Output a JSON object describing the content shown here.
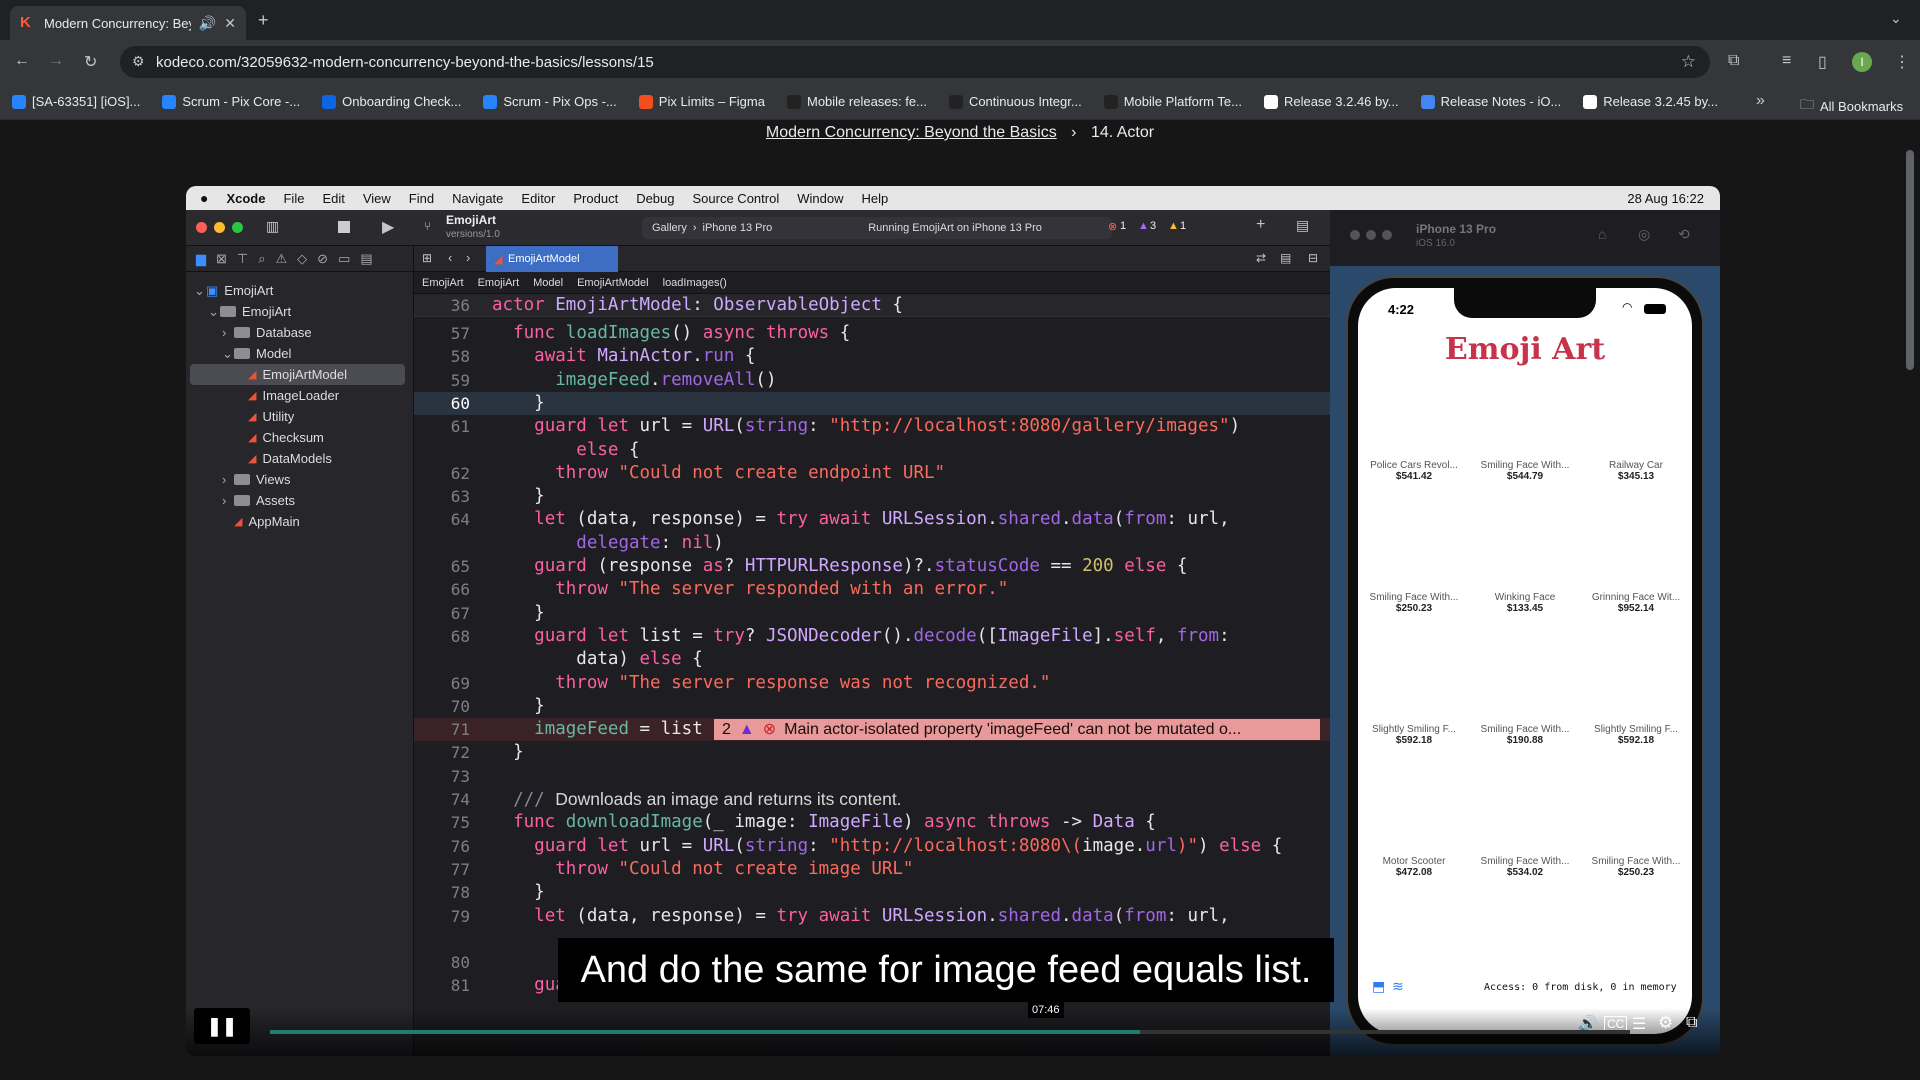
{
  "browser": {
    "tab_title": "Modern Concurrency: Beyo",
    "url": "kodeco.com/32059632-modern-concurrency-beyond-the-basics/lessons/15",
    "bookmarks": [
      {
        "label": "[SA-63351] [iOS]...",
        "color": "#2684ff"
      },
      {
        "label": "Scrum - Pix Core -...",
        "color": "#2684ff"
      },
      {
        "label": "Onboarding Check...",
        "color": "#0c66e4"
      },
      {
        "label": "Scrum - Pix Ops -...",
        "color": "#2684ff"
      },
      {
        "label": "Pix Limits – Figma",
        "color": "#f24e1e"
      },
      {
        "label": "Mobile releases: fe...",
        "color": "#222222"
      },
      {
        "label": "Continuous Integr...",
        "color": "#222222"
      },
      {
        "label": "Mobile Platform Te...",
        "color": "#222222"
      },
      {
        "label": "Release 3.2.46 by...",
        "color": "#ffffff"
      },
      {
        "label": "Release Notes - iO...",
        "color": "#4285f4"
      },
      {
        "label": "Release 3.2.45 by...",
        "color": "#ffffff"
      }
    ],
    "all_bookmarks": "All Bookmarks",
    "more": "»"
  },
  "breadcrumb": {
    "course": "Modern Concurrency: Beyond the Basics",
    "sep": "›",
    "lesson": "14. Actor"
  },
  "mac_menu": [
    "Xcode",
    "File",
    "Edit",
    "View",
    "Find",
    "Navigate",
    "Editor",
    "Product",
    "Debug",
    "Source Control",
    "Window",
    "Help"
  ],
  "mac_status": "28 Aug  16:22",
  "xcode": {
    "project": "EmojiArt",
    "version": "versions/1.0",
    "scheme": "Gallery",
    "device": "iPhone 13 Pro",
    "status": "Running EmojiArt on iPhone 13 Pro",
    "errors": "1",
    "warnings_purple": "3",
    "warnings_yellow": "1",
    "file_tab": "EmojiArtModel",
    "jump": [
      "EmojiArt",
      "EmojiArt",
      "Model",
      "EmojiArtModel",
      "loadImages()"
    ],
    "navigator": [
      {
        "label": "EmojiArt",
        "depth": 0,
        "kind": "project",
        "arrow": "⌄"
      },
      {
        "label": "EmojiArt",
        "depth": 1,
        "kind": "folder",
        "arrow": "⌄"
      },
      {
        "label": "Database",
        "depth": 2,
        "kind": "folder",
        "arrow": "›"
      },
      {
        "label": "Model",
        "depth": 2,
        "kind": "folder",
        "arrow": "⌄"
      },
      {
        "label": "EmojiArtModel",
        "depth": 3,
        "kind": "swift",
        "arrow": ""
      },
      {
        "label": "ImageLoader",
        "depth": 3,
        "kind": "swift",
        "arrow": ""
      },
      {
        "label": "Utility",
        "depth": 3,
        "kind": "swift",
        "arrow": ""
      },
      {
        "label": "Checksum",
        "depth": 3,
        "kind": "swift",
        "arrow": ""
      },
      {
        "label": "DataModels",
        "depth": 3,
        "kind": "swift",
        "arrow": ""
      },
      {
        "label": "Views",
        "depth": 2,
        "kind": "folder",
        "arrow": "›"
      },
      {
        "label": "Assets",
        "depth": 2,
        "kind": "folder",
        "arrow": "›"
      },
      {
        "label": "AppMain",
        "depth": 2,
        "kind": "swift",
        "arrow": ""
      }
    ],
    "sticky_line": {
      "num": "36",
      "html": "<span class='kw'>actor</span> <span class='ty'>EmojiArtModel</span>: <span class='ty'>ObservableObject</span> {"
    },
    "code": [
      {
        "num": "57",
        "html": "  <span class='kw'>func</span> <span class='fn'>loadImages</span>() <span class='kw'>async throws</span> {"
      },
      {
        "num": "58",
        "html": "    <span class='kw'>await</span> <span class='ty'>MainActor</span>.<span class='id'>run</span> {"
      },
      {
        "num": "59",
        "html": "      <span class='fn'>imageFeed</span>.<span class='id'>removeAll</span>()"
      },
      {
        "num": "60",
        "html": "    }",
        "current": true
      },
      {
        "num": "61",
        "html": "    <span class='kw'>guard let</span> url = <span class='ty'>URL</span>(<span class='id'>string</span>: <span class='st'>\"http://localhost:8080/gallery/images\"</span>)"
      },
      {
        "num": "",
        "html": "        <span class='kw'>else</span> {"
      },
      {
        "num": "62",
        "html": "      <span class='kw'>throw</span> <span class='st'>\"Could not create endpoint URL\"</span>"
      },
      {
        "num": "63",
        "html": "    }"
      },
      {
        "num": "64",
        "html": "    <span class='kw'>let</span> (data, response) = <span class='kw'>try await</span> <span class='ty'>URLSession</span>.<span class='id'>shared</span>.<span class='id'>data</span>(<span class='id'>from</span>: url,"
      },
      {
        "num": "",
        "html": "        <span class='id'>delegate</span>: <span class='kw'>nil</span>)"
      },
      {
        "num": "65",
        "html": "    <span class='kw'>guard</span> (response <span class='kw'>as</span>? <span class='ty'>HTTPURLResponse</span>)?.<span class='id'>statusCode</span> == <span class='nm'>200</span> <span class='kw'>else</span> {"
      },
      {
        "num": "66",
        "html": "      <span class='kw'>throw</span> <span class='st'>\"The server responded with an error.\"</span>"
      },
      {
        "num": "67",
        "html": "    }"
      },
      {
        "num": "68",
        "html": "    <span class='kw'>guard let</span> list = <span class='kw'>try</span>? <span class='ty'>JSONDecoder</span>().<span class='id'>decode</span>([<span class='ty'>ImageFile</span>].<span class='kw'>self</span>, <span class='id'>from</span>:"
      },
      {
        "num": "",
        "html": "        data) <span class='kw'>else</span> {"
      },
      {
        "num": "69",
        "html": "      <span class='kw'>throw</span> <span class='st'>\"The server response was not recognized.\"</span>"
      },
      {
        "num": "70",
        "html": "    }"
      },
      {
        "num": "71",
        "html": "    <span class='fn'>imageFeed</span> = list",
        "error": true
      },
      {
        "num": "72",
        "html": "  }"
      },
      {
        "num": "73",
        "html": ""
      },
      {
        "num": "74",
        "html": "  <span class='cm'>/// </span><span class='cmt'>Downloads an image and returns its content.</span>"
      },
      {
        "num": "75",
        "html": "  <span class='kw'>func</span> <span class='fn'>downloadImage</span>(_ image: <span class='ty'>ImageFile</span>) <span class='kw'>async throws</span> -> <span class='ty'>Data</span> {"
      },
      {
        "num": "76",
        "html": "    <span class='kw'>guard let</span> url = <span class='ty'>URL</span>(<span class='id'>string</span>: <span class='st'>\"http://localhost:8080\\(</span>image.<span class='id'>url</span><span class='st'>)\"</span>) <span class='kw'>else</span> {"
      },
      {
        "num": "77",
        "html": "      <span class='kw'>throw</span> <span class='st'>\"Could not create image URL\"</span>"
      },
      {
        "num": "78",
        "html": "    }"
      },
      {
        "num": "79",
        "html": "    <span class='kw'>let</span> (data, response) = <span class='kw'>try await</span> <span class='ty'>URLSession</span>.<span class='id'>shared</span>.<span class='id'>data</span>(<span class='id'>from</span>: url,"
      },
      {
        "num": "",
        "html": ""
      },
      {
        "num": "80",
        "html": ""
      },
      {
        "num": "81",
        "html": "    <span class='kw'>guard</span> (response <span class='kw'>as</span>? <span class='ty'>HTTPURLResponse</span>)?.<span class='id'>statusCode</span> == <span class='nm'>200</span> <span class='kw'>else</span> {"
      }
    ],
    "error_count": "2",
    "error_message": "Main actor-isolated property 'imageFeed' can not be mutated o..."
  },
  "simulator": {
    "device": "iPhone 13 Pro",
    "os": "iOS 16.0",
    "time": "4:22",
    "app_title": "Emoji Art",
    "items": [
      {
        "name": "Police Cars Revol...",
        "price": "$541.42"
      },
      {
        "name": "Smiling Face With...",
        "price": "$544.79"
      },
      {
        "name": "Railway Car",
        "price": "$345.13"
      },
      {
        "name": "Smiling Face With...",
        "price": "$250.23"
      },
      {
        "name": "Winking Face",
        "price": "$133.45"
      },
      {
        "name": "Grinning Face Wit...",
        "price": "$952.14"
      },
      {
        "name": "Slightly Smiling F...",
        "price": "$592.18"
      },
      {
        "name": "Smiling Face With...",
        "price": "$190.88"
      },
      {
        "name": "Slightly Smiling F...",
        "price": "$592.18"
      },
      {
        "name": "Motor Scooter",
        "price": "$472.08"
      },
      {
        "name": "Smiling Face With...",
        "price": "$534.02"
      },
      {
        "name": "Smiling Face With...",
        "price": "$250.23"
      }
    ],
    "footer": "Access: 0 from disk, 0 in memory"
  },
  "video": {
    "caption": "And do the same for image feed equals list.",
    "time_tooltip": "07:46",
    "progress_fraction": 0.64
  }
}
